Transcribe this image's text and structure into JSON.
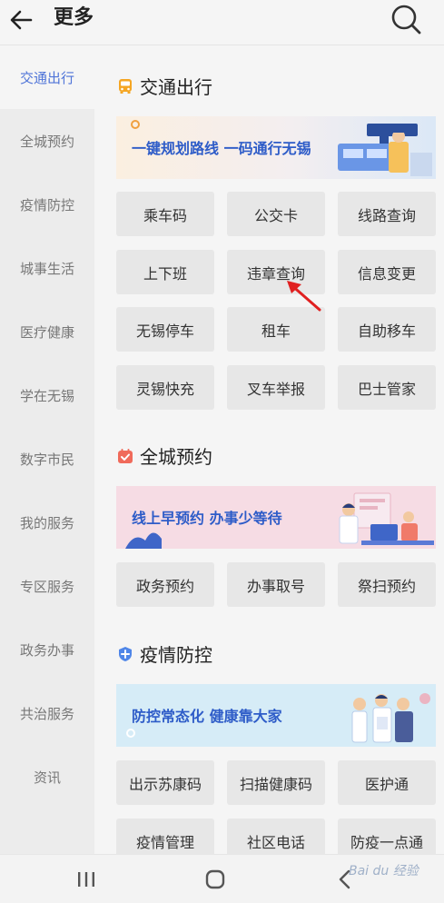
{
  "header": {
    "title": "更多"
  },
  "sidebar": {
    "items": [
      {
        "label": "交通出行",
        "active": true
      },
      {
        "label": "全城预约"
      },
      {
        "label": "疫情防控"
      },
      {
        "label": "城事生活"
      },
      {
        "label": "医疗健康"
      },
      {
        "label": "学在无锡"
      },
      {
        "label": "数字市民"
      },
      {
        "label": "我的服务"
      },
      {
        "label": "专区服务"
      },
      {
        "label": "政务办事"
      },
      {
        "label": "共治服务"
      },
      {
        "label": "资讯"
      }
    ]
  },
  "sections": {
    "traffic": {
      "title": "交通出行",
      "banner": "一键规划路线 一码通行无锡",
      "tiles": [
        "乘车码",
        "公交卡",
        "线路查询",
        "上下班",
        "违章查询",
        "信息变更",
        "无锡停车",
        "租车",
        "自助移车",
        "灵锡快充",
        "叉车举报",
        "巴士管家"
      ]
    },
    "booking": {
      "title": "全城预约",
      "banner": "线上早预约 办事少等待",
      "tiles": [
        "政务预约",
        "办事取号",
        "祭扫预约"
      ]
    },
    "epidemic": {
      "title": "疫情防控",
      "banner": "防控常态化 健康靠大家",
      "tiles": [
        "出示苏康码",
        "扫描健康码",
        "医护通",
        "疫情管理",
        "社区电话",
        "防疫一点通"
      ]
    }
  },
  "watermark": "Bai du 经验",
  "colors": {
    "accent": "#4f74d8",
    "banner_text": "#2e5cc8",
    "arrow": "#e02020"
  },
  "icons": [
    "back-arrow-icon",
    "search-icon",
    "bus-icon",
    "calendar-check-icon",
    "shield-icon",
    "recent-apps-icon",
    "home-icon",
    "back-nav-icon"
  ]
}
